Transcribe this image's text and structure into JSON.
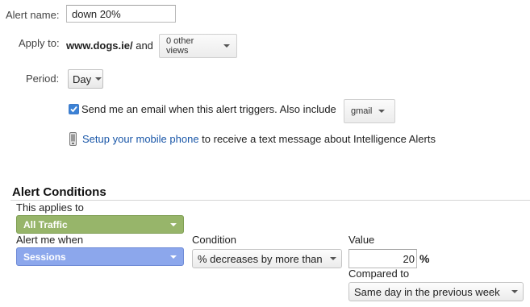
{
  "form": {
    "alert_name_label": "Alert name:",
    "alert_name_value": "down 20%",
    "apply_to_label": "Apply to:",
    "apply_to_site": "www.dogs.ie/",
    "apply_to_and": "and",
    "other_views_button": "0 other views",
    "period_label": "Period:",
    "period_value": "Day",
    "email_checkbox_checked": true,
    "email_text": "Send me an email when this alert triggers. Also include",
    "include_button": "gmail",
    "mobile_link": "Setup your mobile phone",
    "mobile_text": "to receive a text message about Intelligence Alerts"
  },
  "conditions": {
    "title": "Alert Conditions",
    "applies_to_label": "This applies to",
    "applies_to_value": "All Traffic",
    "alert_when_label": "Alert me when",
    "alert_when_value": "Sessions",
    "condition_label": "Condition",
    "condition_value": "% decreases by more than",
    "value_label": "Value",
    "value_input": "20",
    "value_unit": "%",
    "compared_label": "Compared to",
    "compared_value": "Same day in the previous week"
  },
  "colors": {
    "green_select": "#97b56a",
    "blue_select": "#8ca7ec",
    "link": "#1a57a8",
    "checkbox": "#3b82d6"
  },
  "icons": [
    "mobile-phone-icon",
    "chevron-down-icon",
    "checkmark-icon"
  ]
}
